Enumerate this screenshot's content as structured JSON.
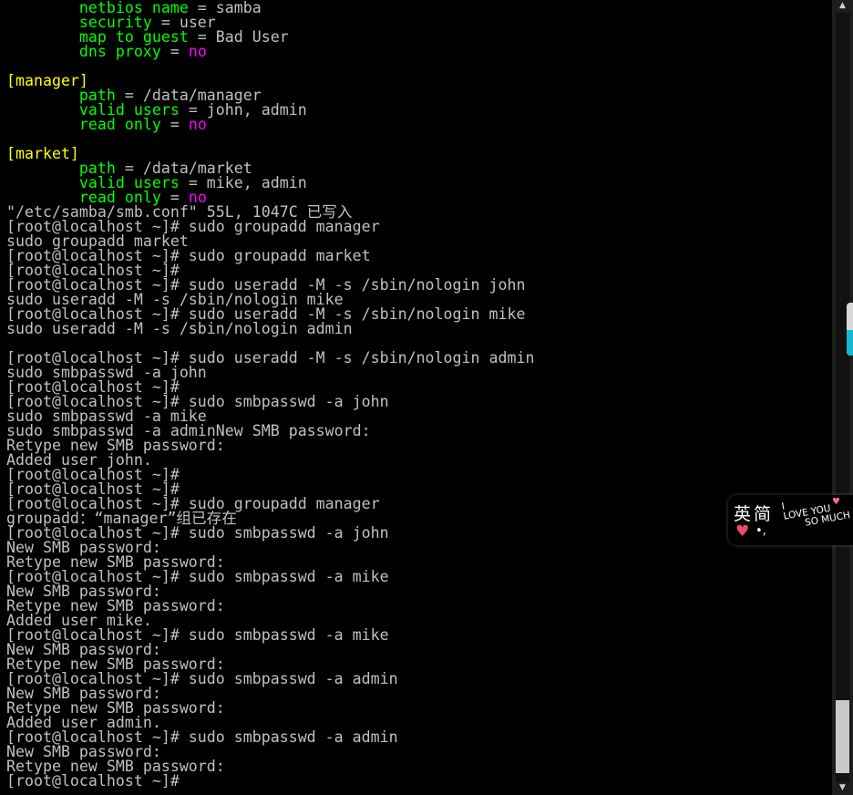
{
  "colors": {
    "background": "#000000",
    "default_text": "#c0c0c0",
    "key": "#00ff00",
    "value_no": "#ff00ff",
    "section": "#ffff00",
    "ime_accent": "#15b8d0",
    "ime_heart": "#f04a6a"
  },
  "terminal": {
    "lines": [
      [
        {
          "text": "        netbios name",
          "color": "#00ff00"
        },
        {
          "text": " = samba",
          "color": "#c0c0c0"
        }
      ],
      [
        {
          "text": "        security",
          "color": "#00ff00"
        },
        {
          "text": " = user",
          "color": "#c0c0c0"
        }
      ],
      [
        {
          "text": "        map to guest",
          "color": "#00ff00"
        },
        {
          "text": " = Bad User",
          "color": "#c0c0c0"
        }
      ],
      [
        {
          "text": "        dns proxy",
          "color": "#00ff00"
        },
        {
          "text": " = ",
          "color": "#c0c0c0"
        },
        {
          "text": "no",
          "color": "#ff00ff"
        }
      ],
      [],
      [
        {
          "text": "[manager]",
          "color": "#ffff00"
        }
      ],
      [
        {
          "text": "        path",
          "color": "#00ff00"
        },
        {
          "text": " = /data/manager",
          "color": "#c0c0c0"
        }
      ],
      [
        {
          "text": "        valid users",
          "color": "#00ff00"
        },
        {
          "text": " = john, admin",
          "color": "#c0c0c0"
        }
      ],
      [
        {
          "text": "        read only",
          "color": "#00ff00"
        },
        {
          "text": " = ",
          "color": "#c0c0c0"
        },
        {
          "text": "no",
          "color": "#ff00ff"
        }
      ],
      [],
      [
        {
          "text": "[market]",
          "color": "#ffff00"
        }
      ],
      [
        {
          "text": "        path",
          "color": "#00ff00"
        },
        {
          "text": " = /data/market",
          "color": "#c0c0c0"
        }
      ],
      [
        {
          "text": "        valid users",
          "color": "#00ff00"
        },
        {
          "text": " = mike, admin",
          "color": "#c0c0c0"
        }
      ],
      [
        {
          "text": "        read only",
          "color": "#00ff00"
        },
        {
          "text": " = ",
          "color": "#c0c0c0"
        },
        {
          "text": "no",
          "color": "#ff00ff"
        }
      ],
      [
        {
          "text": "\"/etc/samba/smb.conf\" 55L, 1047C 已写入",
          "color": "#c0c0c0"
        }
      ],
      [
        {
          "text": "[root@localhost ~]# sudo groupadd manager",
          "color": "#c0c0c0"
        }
      ],
      [
        {
          "text": "sudo groupadd market",
          "color": "#c0c0c0"
        }
      ],
      [
        {
          "text": "[root@localhost ~]# sudo groupadd market",
          "color": "#c0c0c0"
        }
      ],
      [
        {
          "text": "[root@localhost ~]#",
          "color": "#c0c0c0"
        }
      ],
      [
        {
          "text": "[root@localhost ~]# sudo useradd -M -s /sbin/nologin john",
          "color": "#c0c0c0"
        }
      ],
      [
        {
          "text": "sudo useradd -M -s /sbin/nologin mike",
          "color": "#c0c0c0"
        }
      ],
      [
        {
          "text": "[root@localhost ~]# sudo useradd -M -s /sbin/nologin mike",
          "color": "#c0c0c0"
        }
      ],
      [
        {
          "text": "sudo useradd -M -s /sbin/nologin admin",
          "color": "#c0c0c0"
        }
      ],
      [],
      [
        {
          "text": "[root@localhost ~]# sudo useradd -M -s /sbin/nologin admin",
          "color": "#c0c0c0"
        }
      ],
      [
        {
          "text": "sudo smbpasswd -a john",
          "color": "#c0c0c0"
        }
      ],
      [
        {
          "text": "[root@localhost ~]#",
          "color": "#c0c0c0"
        }
      ],
      [
        {
          "text": "[root@localhost ~]# sudo smbpasswd -a john",
          "color": "#c0c0c0"
        }
      ],
      [
        {
          "text": "sudo smbpasswd -a mike",
          "color": "#c0c0c0"
        }
      ],
      [
        {
          "text": "sudo smbpasswd -a adminNew SMB password:",
          "color": "#c0c0c0"
        }
      ],
      [
        {
          "text": "Retype new SMB password:",
          "color": "#c0c0c0"
        }
      ],
      [
        {
          "text": "Added user john.",
          "color": "#c0c0c0"
        }
      ],
      [
        {
          "text": "[root@localhost ~]#",
          "color": "#c0c0c0"
        }
      ],
      [
        {
          "text": "[root@localhost ~]#",
          "color": "#c0c0c0"
        }
      ],
      [
        {
          "text": "[root@localhost ~]# sudo groupadd manager",
          "color": "#c0c0c0"
        }
      ],
      [
        {
          "text": "groupadd：“manager”组已存在",
          "color": "#c0c0c0"
        }
      ],
      [
        {
          "text": "[root@localhost ~]# sudo smbpasswd -a john",
          "color": "#c0c0c0"
        }
      ],
      [
        {
          "text": "New SMB password:",
          "color": "#c0c0c0"
        }
      ],
      [
        {
          "text": "Retype new SMB password:",
          "color": "#c0c0c0"
        }
      ],
      [
        {
          "text": "[root@localhost ~]# sudo smbpasswd -a mike",
          "color": "#c0c0c0"
        }
      ],
      [
        {
          "text": "New SMB password:",
          "color": "#c0c0c0"
        }
      ],
      [
        {
          "text": "Retype new SMB password:",
          "color": "#c0c0c0"
        }
      ],
      [
        {
          "text": "Added user mike.",
          "color": "#c0c0c0"
        }
      ],
      [
        {
          "text": "[root@localhost ~]# sudo smbpasswd -a mike",
          "color": "#c0c0c0"
        }
      ],
      [
        {
          "text": "New SMB password:",
          "color": "#c0c0c0"
        }
      ],
      [
        {
          "text": "Retype new SMB password:",
          "color": "#c0c0c0"
        }
      ],
      [
        {
          "text": "[root@localhost ~]# sudo smbpasswd -a admin",
          "color": "#c0c0c0"
        }
      ],
      [
        {
          "text": "New SMB password:",
          "color": "#c0c0c0"
        }
      ],
      [
        {
          "text": "Retype new SMB password:",
          "color": "#c0c0c0"
        }
      ],
      [
        {
          "text": "Added user admin.",
          "color": "#c0c0c0"
        }
      ],
      [
        {
          "text": "[root@localhost ~]# sudo smbpasswd -a admin",
          "color": "#c0c0c0"
        }
      ],
      [
        {
          "text": "New SMB password:",
          "color": "#c0c0c0"
        }
      ],
      [
        {
          "text": "Retype new SMB password:",
          "color": "#c0c0c0"
        }
      ],
      [
        {
          "text": "[root@localhost ~]#",
          "color": "#c0c0c0"
        }
      ]
    ]
  },
  "scrollbar": {
    "up_icon": "up-arrow-icon",
    "down_icon": "down-arrow-icon",
    "up_glyph": "▲",
    "down_glyph": "▼",
    "position_fraction": 0.95
  },
  "ime_toolbar": {
    "lang_label": "英简",
    "punct_label": "•,",
    "slogan_lines": [
      "I",
      "LOVE YOU",
      "SO MUCH"
    ],
    "heart_glyph": "♥",
    "heart_icon": "heart-icon"
  }
}
